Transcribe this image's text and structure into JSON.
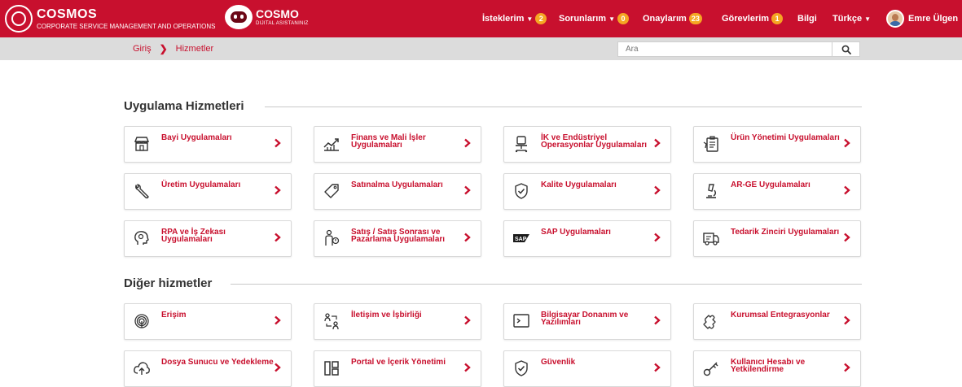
{
  "header": {
    "brand_title": "COSMOS",
    "brand_subtitle": "CORPORATE SERVICE MANAGEMENT AND OPERATIONS",
    "assistant_title": "COSMO",
    "assistant_subtitle": "DIJITAL ASISTANINIZ",
    "nav": {
      "requests_label": "İsteklerim",
      "requests_count": "2",
      "problems_label": "Sorunlarım",
      "problems_count": "0",
      "approvals_label": "Onaylarım",
      "approvals_count": "23",
      "tasks_label": "Görevlerim",
      "tasks_count": "1",
      "info_label": "Bilgi",
      "language_label": "Türkçe",
      "user_name": "Emre Ülgen"
    },
    "colors": {
      "brand": "#c8102e",
      "badge": "#f5a623"
    }
  },
  "breadcrumb": {
    "home": "Giriş",
    "current": "Hizmetler"
  },
  "search": {
    "placeholder": "Ara",
    "value": ""
  },
  "sections": {
    "app_services": {
      "title": "Uygulama Hizmetleri",
      "cards": [
        {
          "label": "Bayi Uygulamaları",
          "icon": "store-icon"
        },
        {
          "label": "Finans ve Mali İşler Uygulamaları",
          "icon": "finance-chart-icon"
        },
        {
          "label": "İK ve Endüstriyel Operasyonlar Uygulamaları",
          "icon": "office-chair-icon"
        },
        {
          "label": "Ürün Yönetimi Uygulamaları",
          "icon": "product-clipboard-icon"
        },
        {
          "label": "Üretim Uygulamaları",
          "icon": "wrench-icon"
        },
        {
          "label": "Satınalma Uygulamaları",
          "icon": "price-tag-icon"
        },
        {
          "label": "Kalite Uygulamaları",
          "icon": "shield-check-icon"
        },
        {
          "label": "AR-GE Uygulamaları",
          "icon": "microscope-icon"
        },
        {
          "label": "RPA ve İş Zekası Uygulamaları",
          "icon": "brain-robot-icon"
        },
        {
          "label": "Satış / Satış Sonrası ve Pazarlama Uygulamaları",
          "icon": "salesperson-icon"
        },
        {
          "label": "SAP Uygulamaları",
          "icon": "sap-logo-icon"
        },
        {
          "label": "Tedarik Zinciri Uygulamaları",
          "icon": "delivery-truck-icon"
        }
      ]
    },
    "other_services": {
      "title": "Diğer hizmetler",
      "cards": [
        {
          "label": "Erişim",
          "icon": "fingerprint-icon"
        },
        {
          "label": "İletişim ve İşbirliği",
          "icon": "collaboration-icon"
        },
        {
          "label": "Bilgisayar Donanım ve Yazılımları",
          "icon": "terminal-icon"
        },
        {
          "label": "Kurumsal Entegrasyonlar",
          "icon": "puzzle-icon"
        },
        {
          "label": "Dosya Sunucu ve Yedekleme",
          "icon": "cloud-upload-icon"
        },
        {
          "label": "Portal ve İçerik Yönetimi",
          "icon": "layout-grid-icon"
        },
        {
          "label": "Güvenlik",
          "icon": "shield-check-icon"
        },
        {
          "label": "Kullanıcı Hesabı ve Yetkilendirme",
          "icon": "key-icon"
        }
      ]
    }
  }
}
